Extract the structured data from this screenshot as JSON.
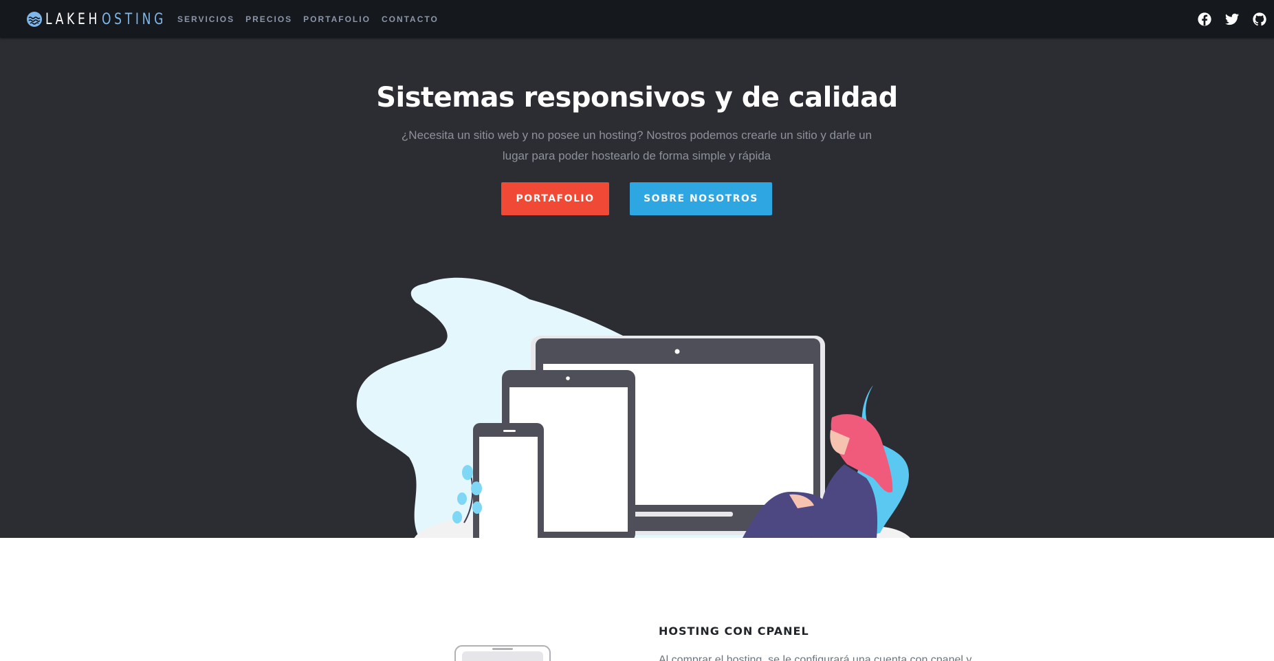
{
  "navbar": {
    "brand_a": "LAKEH",
    "brand_b": "OSTING",
    "links": [
      {
        "label": "SERVICIOS"
      },
      {
        "label": "PRECIOS"
      },
      {
        "label": "PORTAFOLIO"
      },
      {
        "label": "CONTACTO"
      }
    ],
    "social": [
      "facebook-icon",
      "twitter-icon",
      "github-icon"
    ]
  },
  "hero": {
    "title": "Sistemas responsivos y de calidad",
    "subtitle": "¿Necesita un sitio web y no posee un hosting? Nostros podemos crearle un sitio y darle un lugar para poder hostearlo de forma simple y rápida",
    "buttons": {
      "portafolio": "PORTAFOLIO",
      "nosotros": "SOBRE NOSOTROS"
    }
  },
  "features": {
    "title": "HOSTING CON CPANEL",
    "text": "Al comprar el hosting, se le configurará una cuenta con cpanel y"
  },
  "colors": {
    "navbar_bg": "#15181d",
    "hero_bg": "#2b2d33",
    "btn_red": "#f04a36",
    "btn_blue": "#2ea6e1",
    "brand_accent": "#7fb7ea"
  }
}
